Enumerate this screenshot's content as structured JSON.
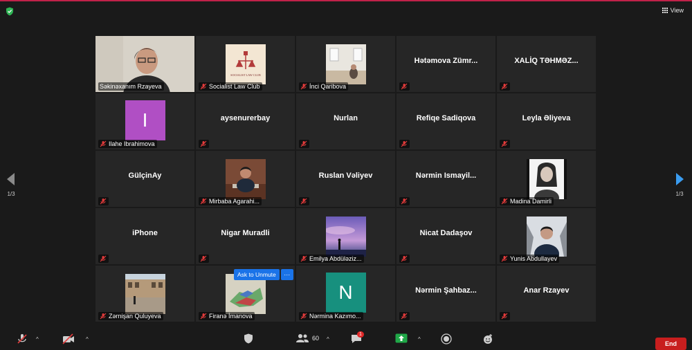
{
  "header": {
    "view_label": "View",
    "security_color": "#2fb454"
  },
  "page_indicator": "1/3",
  "tiles": [
    {
      "name": "Səkinəxanım Rzayeva",
      "type": "video-woman"
    },
    {
      "name": "Socialist Law Club",
      "type": "logo",
      "logo_text": "SOCIALIST LAW CLUB"
    },
    {
      "name": "İnci Qaribova",
      "type": "photo-room"
    },
    {
      "name": "Hətəmova  Zümr...",
      "type": "text"
    },
    {
      "name": "XALİQ  TƏHMƏZ...",
      "type": "text"
    },
    {
      "name": "Ilahe Ibrahimova",
      "type": "letter",
      "letter": "I",
      "letter_bg": "#b04fc4"
    },
    {
      "name": "aysenurerbay",
      "type": "text"
    },
    {
      "name": "Nurlan",
      "type": "text"
    },
    {
      "name": "Refiqe Sadiqova",
      "type": "text"
    },
    {
      "name": "Leyla Əliyeva",
      "type": "text"
    },
    {
      "name": "GülçinAy",
      "type": "text"
    },
    {
      "name": "Mirbaba Agarahi...",
      "type": "photo-man-desk"
    },
    {
      "name": "Ruslan Vəliyev",
      "type": "text"
    },
    {
      "name": "Nərmin  Ismayil...",
      "type": "text"
    },
    {
      "name": "Madina Damirli",
      "type": "photo-portrait"
    },
    {
      "name": "iPhone",
      "type": "text"
    },
    {
      "name": "Nigar Muradli",
      "type": "text"
    },
    {
      "name": "Emilya Abdüləziz...",
      "type": "photo-sky"
    },
    {
      "name": "Nicat Dadaşov",
      "type": "text"
    },
    {
      "name": "Yunis Abdullayev",
      "type": "photo-winter"
    },
    {
      "name": "Zərnişan Quluyeva",
      "type": "photo-building"
    },
    {
      "name": "Firanə İmanova",
      "type": "photo-map"
    },
    {
      "name": "Nərmina Kazımo...",
      "type": "letter",
      "letter": "N",
      "letter_bg": "#17907e"
    },
    {
      "name": "Nərmin  Şahbaz...",
      "type": "text"
    },
    {
      "name": "Anar Rzayev",
      "type": "text"
    }
  ],
  "hover_actions": {
    "ask_to_unmute": "Ask to Unmute",
    "more": "···"
  },
  "toolbar": {
    "participants_count": "60",
    "chat_badge": "1",
    "end_label": "End",
    "share_color": "#20a848",
    "end_color": "#c81e1e"
  }
}
